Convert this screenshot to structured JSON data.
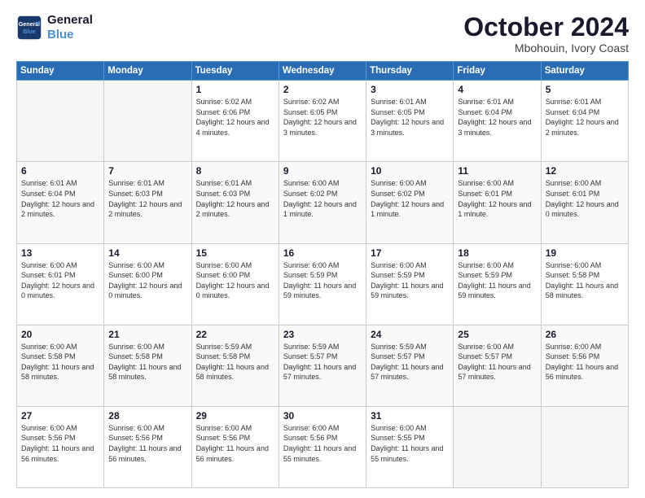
{
  "header": {
    "logo_line1": "General",
    "logo_line2": "Blue",
    "month": "October 2024",
    "location": "Mbohouin, Ivory Coast"
  },
  "weekdays": [
    "Sunday",
    "Monday",
    "Tuesday",
    "Wednesday",
    "Thursday",
    "Friday",
    "Saturday"
  ],
  "weeks": [
    [
      {
        "day": "",
        "info": ""
      },
      {
        "day": "",
        "info": ""
      },
      {
        "day": "1",
        "info": "Sunrise: 6:02 AM\nSunset: 6:06 PM\nDaylight: 12 hours and 4 minutes."
      },
      {
        "day": "2",
        "info": "Sunrise: 6:02 AM\nSunset: 6:05 PM\nDaylight: 12 hours and 3 minutes."
      },
      {
        "day": "3",
        "info": "Sunrise: 6:01 AM\nSunset: 6:05 PM\nDaylight: 12 hours and 3 minutes."
      },
      {
        "day": "4",
        "info": "Sunrise: 6:01 AM\nSunset: 6:04 PM\nDaylight: 12 hours and 3 minutes."
      },
      {
        "day": "5",
        "info": "Sunrise: 6:01 AM\nSunset: 6:04 PM\nDaylight: 12 hours and 2 minutes."
      }
    ],
    [
      {
        "day": "6",
        "info": "Sunrise: 6:01 AM\nSunset: 6:04 PM\nDaylight: 12 hours and 2 minutes."
      },
      {
        "day": "7",
        "info": "Sunrise: 6:01 AM\nSunset: 6:03 PM\nDaylight: 12 hours and 2 minutes."
      },
      {
        "day": "8",
        "info": "Sunrise: 6:01 AM\nSunset: 6:03 PM\nDaylight: 12 hours and 2 minutes."
      },
      {
        "day": "9",
        "info": "Sunrise: 6:00 AM\nSunset: 6:02 PM\nDaylight: 12 hours and 1 minute."
      },
      {
        "day": "10",
        "info": "Sunrise: 6:00 AM\nSunset: 6:02 PM\nDaylight: 12 hours and 1 minute."
      },
      {
        "day": "11",
        "info": "Sunrise: 6:00 AM\nSunset: 6:01 PM\nDaylight: 12 hours and 1 minute."
      },
      {
        "day": "12",
        "info": "Sunrise: 6:00 AM\nSunset: 6:01 PM\nDaylight: 12 hours and 0 minutes."
      }
    ],
    [
      {
        "day": "13",
        "info": "Sunrise: 6:00 AM\nSunset: 6:01 PM\nDaylight: 12 hours and 0 minutes."
      },
      {
        "day": "14",
        "info": "Sunrise: 6:00 AM\nSunset: 6:00 PM\nDaylight: 12 hours and 0 minutes."
      },
      {
        "day": "15",
        "info": "Sunrise: 6:00 AM\nSunset: 6:00 PM\nDaylight: 12 hours and 0 minutes."
      },
      {
        "day": "16",
        "info": "Sunrise: 6:00 AM\nSunset: 5:59 PM\nDaylight: 11 hours and 59 minutes."
      },
      {
        "day": "17",
        "info": "Sunrise: 6:00 AM\nSunset: 5:59 PM\nDaylight: 11 hours and 59 minutes."
      },
      {
        "day": "18",
        "info": "Sunrise: 6:00 AM\nSunset: 5:59 PM\nDaylight: 11 hours and 59 minutes."
      },
      {
        "day": "19",
        "info": "Sunrise: 6:00 AM\nSunset: 5:58 PM\nDaylight: 11 hours and 58 minutes."
      }
    ],
    [
      {
        "day": "20",
        "info": "Sunrise: 6:00 AM\nSunset: 5:58 PM\nDaylight: 11 hours and 58 minutes."
      },
      {
        "day": "21",
        "info": "Sunrise: 6:00 AM\nSunset: 5:58 PM\nDaylight: 11 hours and 58 minutes."
      },
      {
        "day": "22",
        "info": "Sunrise: 5:59 AM\nSunset: 5:58 PM\nDaylight: 11 hours and 58 minutes."
      },
      {
        "day": "23",
        "info": "Sunrise: 5:59 AM\nSunset: 5:57 PM\nDaylight: 11 hours and 57 minutes."
      },
      {
        "day": "24",
        "info": "Sunrise: 5:59 AM\nSunset: 5:57 PM\nDaylight: 11 hours and 57 minutes."
      },
      {
        "day": "25",
        "info": "Sunrise: 6:00 AM\nSunset: 5:57 PM\nDaylight: 11 hours and 57 minutes."
      },
      {
        "day": "26",
        "info": "Sunrise: 6:00 AM\nSunset: 5:56 PM\nDaylight: 11 hours and 56 minutes."
      }
    ],
    [
      {
        "day": "27",
        "info": "Sunrise: 6:00 AM\nSunset: 5:56 PM\nDaylight: 11 hours and 56 minutes."
      },
      {
        "day": "28",
        "info": "Sunrise: 6:00 AM\nSunset: 5:56 PM\nDaylight: 11 hours and 56 minutes."
      },
      {
        "day": "29",
        "info": "Sunrise: 6:00 AM\nSunset: 5:56 PM\nDaylight: 11 hours and 56 minutes."
      },
      {
        "day": "30",
        "info": "Sunrise: 6:00 AM\nSunset: 5:56 PM\nDaylight: 11 hours and 55 minutes."
      },
      {
        "day": "31",
        "info": "Sunrise: 6:00 AM\nSunset: 5:55 PM\nDaylight: 11 hours and 55 minutes."
      },
      {
        "day": "",
        "info": ""
      },
      {
        "day": "",
        "info": ""
      }
    ]
  ]
}
